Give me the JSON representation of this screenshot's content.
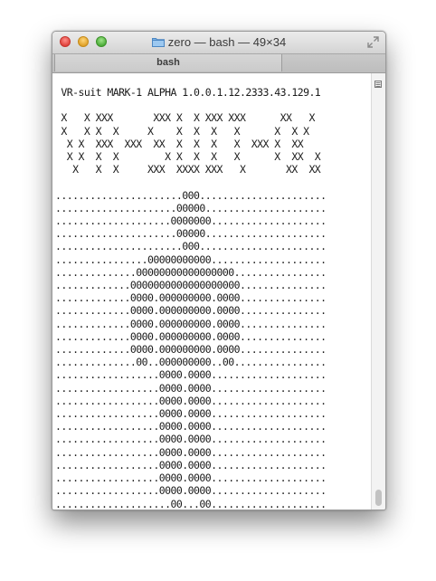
{
  "window": {
    "title": "zero — bash — 49×34",
    "tab_label": "bash",
    "icons": {
      "title_folder": "folder-icon",
      "fullscreen": "fullscreen-icon",
      "scroll_menu": "terminal-menu-icon"
    }
  },
  "terminal": {
    "lines": [
      " VR-suit MARK-1 ALPHA 1.0.0.1.12.2333.43.129.1",
      "",
      " X   X XXX       XXX X  X XXX XXX      XX   X",
      " X   X X  X     X    X  X  X   X      X  X X",
      "  X X  XXX  XXX  XX  X  X  X   X  XXX X  XX",
      "  X X  X  X        X X  X  X   X      X  XX  X",
      "   X   X  X     XXX  XXXX XXX   X       XX  XX",
      "",
      "......................000......................",
      ".....................00000.....................",
      "....................0000000....................",
      ".....................00000.....................",
      "......................000......................",
      "................00000000000....................",
      "..............00000000000000000................",
      ".............0000000000000000000...............",
      ".............0000.000000000.0000...............",
      ".............0000.000000000.0000...............",
      ".............0000.000000000.0000...............",
      ".............0000.000000000.0000...............",
      ".............0000.000000000.0000...............",
      "..............00..000000000..00................",
      "..................0000.0000....................",
      "..................0000.0000....................",
      "..................0000.0000....................",
      "..................0000.0000....................",
      "..................0000.0000....................",
      "..................0000.0000....................",
      "..................0000.0000....................",
      "..................0000.0000....................",
      "..................0000.0000....................",
      "..................0000.0000....................",
      "....................00...00....................",
      "..............................................."
    ]
  }
}
